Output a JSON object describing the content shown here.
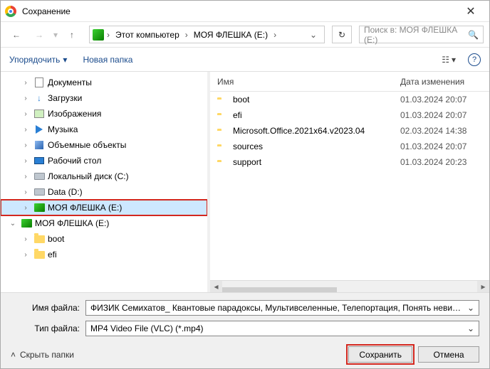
{
  "window": {
    "title": "Сохранение"
  },
  "nav": {
    "breadcrumb": [
      "Этот компьютер",
      "МОЯ ФЛЕШКА (E:)"
    ],
    "search_placeholder": "Поиск в: МОЯ ФЛЕШКА (E:)"
  },
  "toolbar": {
    "organize": "Упорядочить",
    "new_folder": "Новая папка"
  },
  "tree": {
    "items": [
      {
        "label": "Документы",
        "icon": "doc",
        "depth": 1,
        "tw": ">"
      },
      {
        "label": "Загрузки",
        "icon": "dl",
        "depth": 1,
        "tw": ">"
      },
      {
        "label": "Изображения",
        "icon": "pic",
        "depth": 1,
        "tw": ">"
      },
      {
        "label": "Музыка",
        "icon": "mus",
        "depth": 1,
        "tw": ">"
      },
      {
        "label": "Объемные объекты",
        "icon": "cube",
        "depth": 1,
        "tw": ">"
      },
      {
        "label": "Рабочий стол",
        "icon": "desk",
        "depth": 1,
        "tw": ">"
      },
      {
        "label": "Локальный диск (C:)",
        "icon": "hdd",
        "depth": 1,
        "tw": ">"
      },
      {
        "label": "Data (D:)",
        "icon": "hdd",
        "depth": 1,
        "tw": ">"
      },
      {
        "label": "МОЯ ФЛЕШКА (E:)",
        "icon": "usb",
        "depth": 1,
        "tw": ">",
        "selected": true,
        "boxed": true
      },
      {
        "label": "МОЯ ФЛЕШКА (E:)",
        "icon": "usb",
        "depth": 0,
        "tw": "v"
      },
      {
        "label": "boot",
        "icon": "folder",
        "depth": 1,
        "tw": ">"
      },
      {
        "label": "efi",
        "icon": "folder",
        "depth": 1,
        "tw": ">"
      }
    ]
  },
  "files": {
    "columns": {
      "name": "Имя",
      "date": "Дата изменения"
    },
    "rows": [
      {
        "name": "boot",
        "date": "01.03.2024 20:07"
      },
      {
        "name": "efi",
        "date": "01.03.2024 20:07"
      },
      {
        "name": "Microsoft.Office.2021x64.v2023.04",
        "date": "02.03.2024 14:38"
      },
      {
        "name": "sources",
        "date": "01.03.2024 20:07"
      },
      {
        "name": "support",
        "date": "01.03.2024 20:23"
      }
    ]
  },
  "bottom": {
    "filename_label": "Имя файла:",
    "filename_value": "ФИЗИК Семихатов_ Квантовые парадоксы, Мультивселенные, Телепортация, Понять невидимо",
    "filetype_label": "Тип файла:",
    "filetype_value": "MP4 Video File (VLC) (*.mp4)",
    "hide_folders": "Скрыть папки",
    "save": "Сохранить",
    "cancel": "Отмена"
  }
}
